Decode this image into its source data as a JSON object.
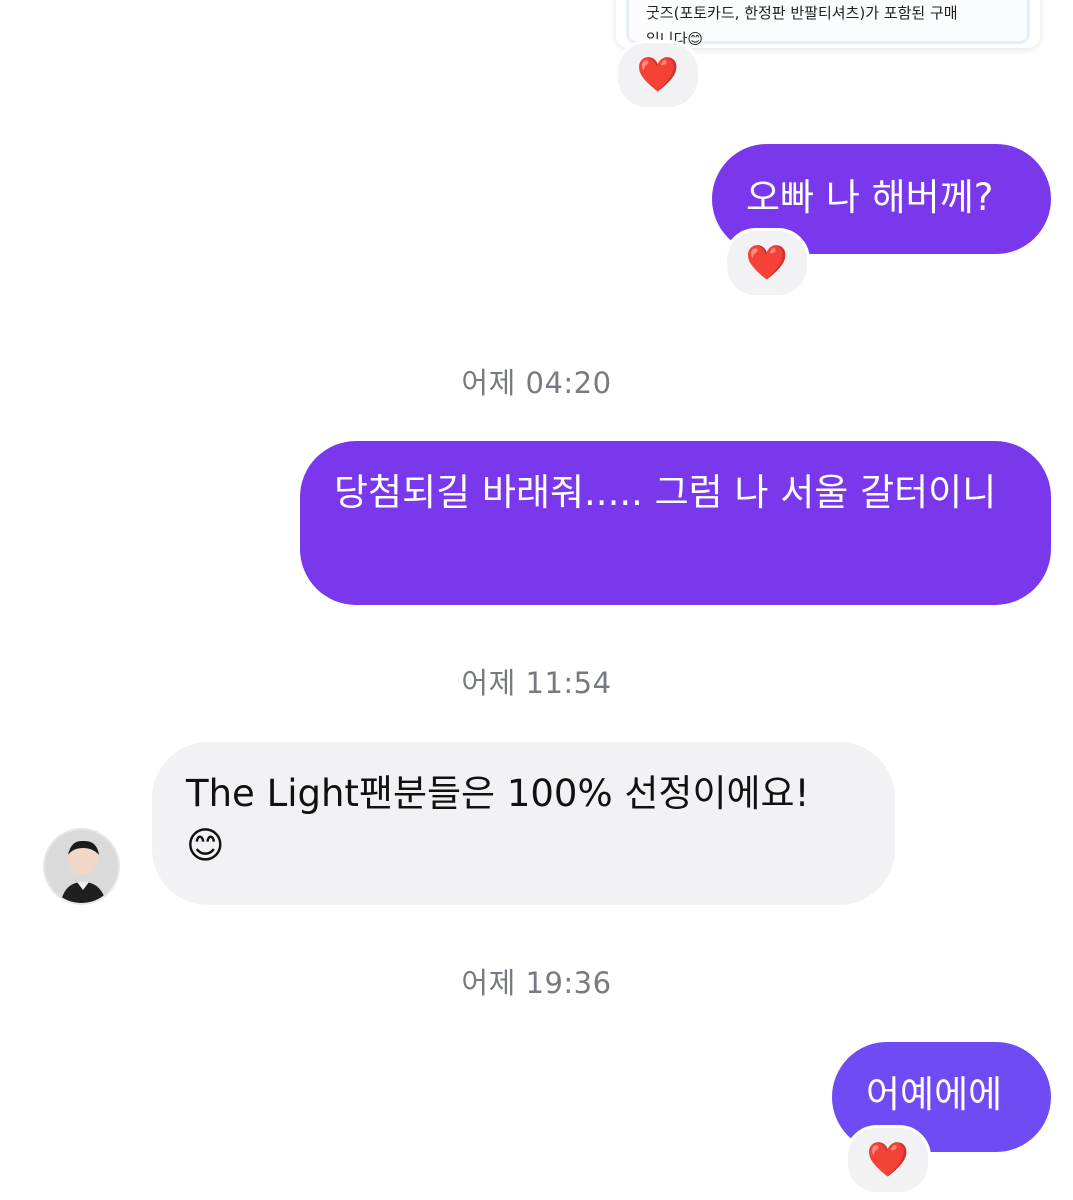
{
  "colors": {
    "my_bubble": "#7a38ec",
    "my_bubble_last": "#6e4bf2",
    "their_bubble": "#f2f2f4",
    "timestamp": "#777a80",
    "reaction_bg": "#f2f2f4"
  },
  "top_card": {
    "text": "굿즈(포토카드, 한정판 반팔티셔츠)가 포함된 구매입니다😊",
    "reaction": "❤️"
  },
  "messages": [
    {
      "sender": "me",
      "text": "오빠 나 해버께?",
      "reaction": "❤️"
    },
    {
      "type": "timestamp",
      "text": "어제 04:20"
    },
    {
      "sender": "me",
      "text": "당첨되길 바래줘..... 그럼 나 서울 갈터이니"
    },
    {
      "type": "timestamp",
      "text": "어제 11:54"
    },
    {
      "sender": "them",
      "text": "The Light팬분들은 100% 선정이에요!\n😊",
      "avatar_icon": "user-avatar-photo"
    },
    {
      "type": "timestamp",
      "text": "어제 19:36"
    },
    {
      "sender": "me",
      "text": "어예에에",
      "reaction": "❤️"
    }
  ]
}
